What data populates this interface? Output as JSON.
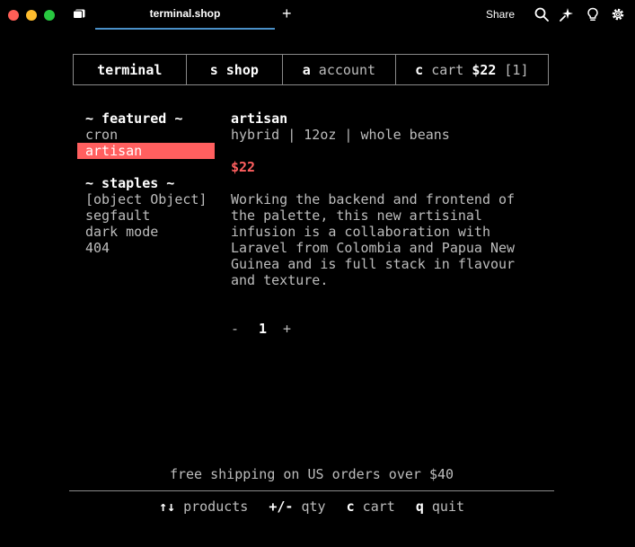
{
  "window": {
    "tab_title": "terminal.shop",
    "new_tab_symbol": "+",
    "share_label": "Share"
  },
  "nav": {
    "brand": "terminal",
    "shop_key": "s",
    "shop_label": "shop",
    "account_key": "a",
    "account_label": "account",
    "cart_key": "c",
    "cart_label": "cart",
    "cart_total": "$22",
    "cart_count": "[1]"
  },
  "list": {
    "featured_heading": "~ featured ~",
    "featured": [
      "cron",
      "artisan"
    ],
    "selected_index": 1,
    "staples_heading": "~ staples ~",
    "staples": [
      "[object Object]",
      "segfault",
      "dark mode",
      "404"
    ]
  },
  "product": {
    "name": "artisan",
    "subtitle": "hybrid | 12oz | whole beans",
    "price": "$22",
    "description_lines": [
      "Working the backend and frontend of",
      "the palette, this new artisinal",
      "infusion is a collaboration with",
      "Laravel from Colombia and Papua New",
      "Guinea and is full stack in flavour",
      "and texture."
    ],
    "qty_minus": "-",
    "quantity": "1",
    "qty_plus": "+"
  },
  "footer": {
    "shipping_note": "free shipping on US orders over $40",
    "products_key": "↑↓",
    "products_label": "products",
    "qty_key": "+/-",
    "qty_label": "qty",
    "cart_key": "c",
    "cart_label": "cart",
    "quit_key": "q",
    "quit_label": "quit"
  },
  "colors": {
    "accent": "#ff5f5f",
    "tab_underline": "#4a90c8",
    "border": "#8a8a8a"
  }
}
